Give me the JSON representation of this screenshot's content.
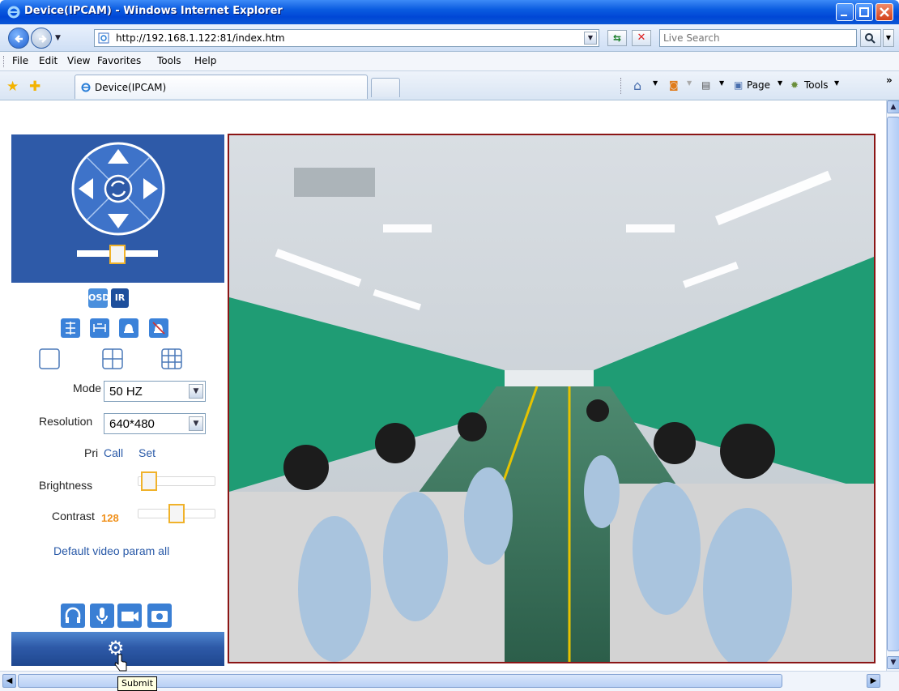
{
  "window": {
    "title": "Device(IPCAM) - Windows Internet Explorer"
  },
  "address": {
    "url": "http://192.168.1.122:81/index.htm",
    "search_placeholder": "Live Search"
  },
  "menu": [
    "File",
    "Edit",
    "View",
    "Favorites",
    "Tools",
    "Help"
  ],
  "tab": {
    "label": "Device(IPCAM)"
  },
  "command_bar": {
    "page_label": "Page",
    "tools_label": "Tools"
  },
  "panel": {
    "osd_label": "OSD",
    "ir_label": "IR",
    "mode": {
      "label": "Mode",
      "value": "50 HZ"
    },
    "resolution": {
      "label": "Resolution",
      "value": "640*480"
    },
    "preset": {
      "label": "Pri",
      "call": "Call",
      "set": "Set"
    },
    "brightness": {
      "label": "Brightness",
      "level": 0.05
    },
    "contrast": {
      "label": "Contrast",
      "value": "128",
      "level": 0.5
    },
    "default_link": "Default video param all"
  },
  "tooltip": "Submit",
  "colors": {
    "panel_blue": "#2e5aa8",
    "accent_orange": "#f0b22a",
    "video_border": "#8b1515"
  }
}
